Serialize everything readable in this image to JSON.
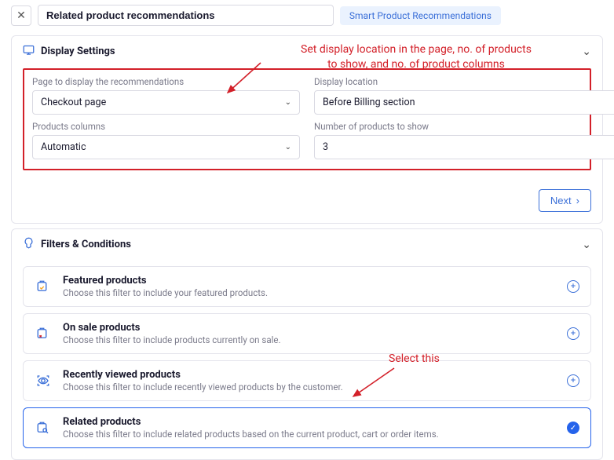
{
  "header": {
    "title_value": "Related product recommendations",
    "smart_tag": "Smart Product Recommendations"
  },
  "display_settings": {
    "title": "Display Settings",
    "page_label": "Page to display the recommendations",
    "page_value": "Checkout page",
    "location_label": "Display location",
    "location_value": "Before Billing section",
    "columns_label": "Products columns",
    "columns_value": "Automatic",
    "count_label": "Number of products to show",
    "count_value": "3",
    "next_label": "Next"
  },
  "filters": {
    "title": "Filters & Conditions",
    "items": [
      {
        "title": "Featured products",
        "desc": "Choose this filter to include your featured products.",
        "icon": "star",
        "selected": false
      },
      {
        "title": "On sale products",
        "desc": "Choose this filter to include products currently on sale.",
        "icon": "x",
        "selected": false
      },
      {
        "title": "Recently viewed products",
        "desc": "Choose this filter to include recently viewed products by the customer.",
        "icon": "eye",
        "selected": false
      },
      {
        "title": "Related products",
        "desc": "Choose this filter to include related products based on the current product, cart or order items.",
        "icon": "search",
        "selected": true
      }
    ]
  },
  "annotations": {
    "top_line1": "Set display location in the page, no. of products",
    "top_line2": "to show, and no. of product columns",
    "select": "Select this"
  }
}
